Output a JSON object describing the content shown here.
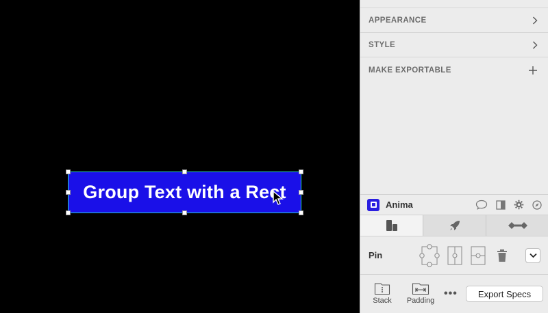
{
  "canvas": {
    "text_layer": "Group Text with a Rect",
    "fill_color": "#1a10e8",
    "selection_color": "#2ad6d6"
  },
  "inspector": {
    "sections": [
      {
        "label": "APPEARANCE",
        "icon": "chevron-right-icon"
      },
      {
        "label": "STYLE",
        "icon": "chevron-right-icon"
      },
      {
        "label": "MAKE EXPORTABLE",
        "icon": "plus-icon"
      }
    ]
  },
  "anima": {
    "name": "Anima",
    "brand_color": "#2a1ee0",
    "header_icons": [
      "comment-icon",
      "panel-icon",
      "gear-icon",
      "compass-icon"
    ],
    "tabs": [
      {
        "icon": "layout-icon",
        "active": true
      },
      {
        "icon": "rocket-icon",
        "active": false
      },
      {
        "icon": "flow-icon",
        "active": false
      }
    ],
    "pin": {
      "label": "Pin",
      "icons": [
        "pin-all-icon",
        "pin-vertical-icon",
        "pin-center-icon",
        "trash-icon"
      ]
    },
    "bottom": {
      "stack_label": "Stack",
      "padding_label": "Padding",
      "more": "•••",
      "export_label": "Export Specs"
    }
  }
}
